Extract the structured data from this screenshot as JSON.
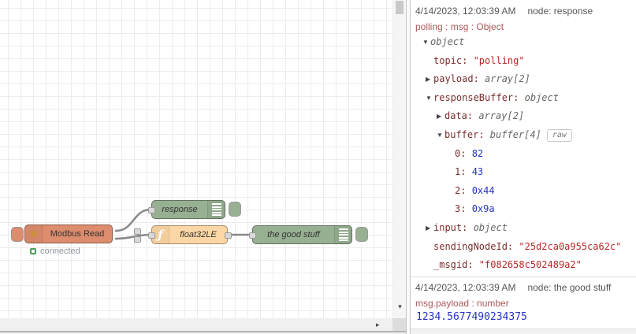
{
  "canvas": {
    "nodes": {
      "modbus": {
        "label": "Modbus Read",
        "status": "connected"
      },
      "response": {
        "label": "response"
      },
      "float": {
        "label": "float32LE"
      },
      "goodstuff": {
        "label": "the good stuff"
      }
    }
  },
  "debug": {
    "messages": [
      {
        "timestamp": "4/14/2023, 12:03:39 AM",
        "node": "node: response",
        "path": "polling : msg : Object",
        "tree": [
          {
            "level": 0,
            "arrow": "down",
            "value": "object",
            "vtype": "type"
          },
          {
            "level": 1,
            "key": "topic",
            "value": "\"polling\"",
            "vtype": "string"
          },
          {
            "level": 1,
            "arrow": "right",
            "key": "payload",
            "value": "array[2]",
            "vtype": "type"
          },
          {
            "level": 1,
            "arrow": "down",
            "key": "responseBuffer",
            "value": "object",
            "vtype": "type"
          },
          {
            "level": 2,
            "arrow": "right",
            "key": "data",
            "value": "array[2]",
            "vtype": "type"
          },
          {
            "level": 2,
            "arrow": "down",
            "key": "buffer",
            "value": "buffer[4]",
            "vtype": "type",
            "button": "raw"
          },
          {
            "level": 3,
            "key": "0",
            "value": "82",
            "vtype": "number"
          },
          {
            "level": 3,
            "key": "1",
            "value": "43",
            "vtype": "number"
          },
          {
            "level": 3,
            "key": "2",
            "value": "0x44",
            "vtype": "number"
          },
          {
            "level": 3,
            "key": "3",
            "value": "0x9a",
            "vtype": "number"
          },
          {
            "level": 1,
            "arrow": "right",
            "key": "input",
            "value": "object",
            "vtype": "type"
          },
          {
            "level": 1,
            "key": "sendingNodeId",
            "value": "\"25d2ca0a955ca62c\"",
            "vtype": "string"
          },
          {
            "level": 1,
            "key": "_msgid",
            "value": "\"f082658c502489a2\"",
            "vtype": "string"
          }
        ]
      },
      {
        "timestamp": "4/14/2023, 12:03:39 AM",
        "node": "node: the good stuff",
        "path": "msg.payload : number",
        "payload": "1234.5677490234375"
      }
    ]
  },
  "icons": {
    "modbus": "modbus-gear-icon",
    "function": "function-f-icon",
    "debug": "debug-list-icon"
  },
  "colors": {
    "modbus_node": "#dd8c6e",
    "debug_node": "#97b092",
    "function_node": "#fcd7a5",
    "port": "#d9d9d9",
    "wire": "#888888",
    "status_ok": "#44a054",
    "status_text": "#9099a6",
    "meta_text": "#565656",
    "msg_path": "#aa5a5a",
    "key": "#7a2e2e",
    "string": "#b72828",
    "number": "#2533c2",
    "type": "#666666",
    "label": "#333333"
  }
}
